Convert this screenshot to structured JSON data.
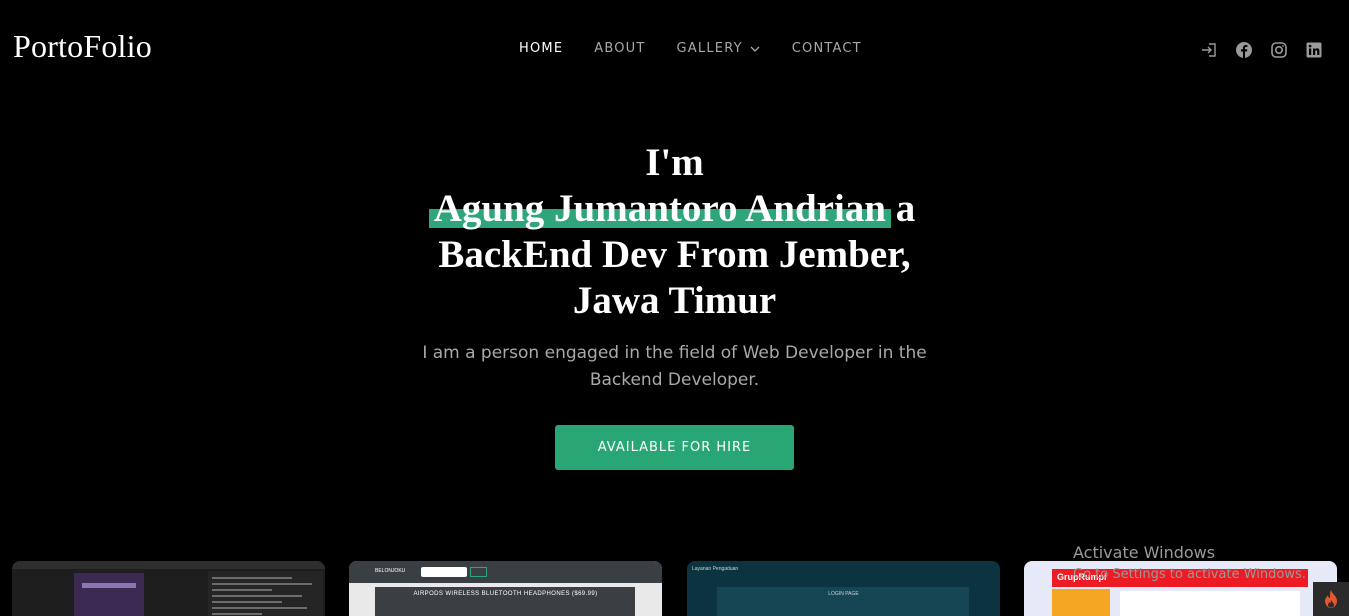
{
  "brand": {
    "logo": "PortoFolio"
  },
  "nav": {
    "items": [
      {
        "label": "HOME",
        "active": true
      },
      {
        "label": "ABOUT",
        "active": false
      },
      {
        "label": "GALLERY",
        "active": false,
        "dropdown": true
      },
      {
        "label": "CONTACT",
        "active": false
      }
    ]
  },
  "socials": [
    {
      "icon": "login-icon"
    },
    {
      "icon": "facebook-icon"
    },
    {
      "icon": "instagram-icon"
    },
    {
      "icon": "linkedin-icon"
    }
  ],
  "hero": {
    "line1": "I'm",
    "highlight": "Agung Jumantoro Andrian",
    "after_highlight": " a",
    "line3": "BackEnd Dev From Jember,",
    "line4": "Jawa Timur",
    "subtitle": "I am a person engaged in the field of Web Developer in the Backend Developer.",
    "cta": "AVAILABLE FOR HIRE",
    "highlight_color": "#2ea57a",
    "cta_color": "#28a774"
  },
  "gallery": {
    "card2_title": "AIRPODS WIRELESS BLUETOOTH HEADPHONES ($69.99)",
    "card2_brand": "BELONJOKU",
    "card3_title": "Layanan Pengaduan",
    "card3_login": "LOGIN PAGE",
    "card4_brand": "GrupRumpi"
  },
  "os_overlay": {
    "watermark_title": "Activate Windows",
    "watermark_sub": "Go to Settings to activate Windows."
  }
}
